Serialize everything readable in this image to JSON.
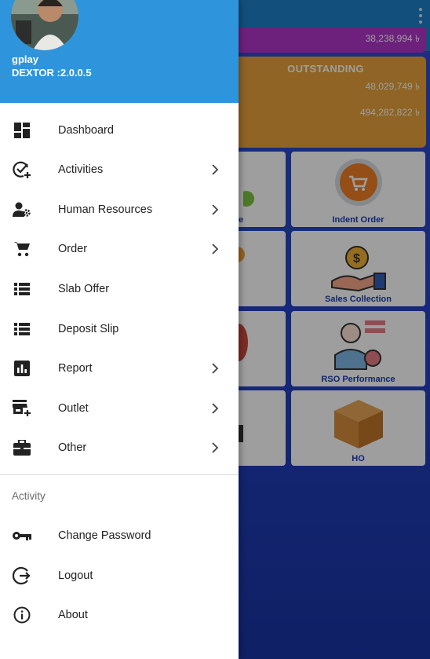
{
  "drawer": {
    "user_name": "gplay",
    "version": "DEXTOR :2.0.0.5",
    "items": [
      {
        "label": "Dashboard",
        "icon": "dashboard-icon",
        "has_submenu": false
      },
      {
        "label": "Activities",
        "icon": "activities-check-icon",
        "has_submenu": true
      },
      {
        "label": "Human Resources",
        "icon": "human-resources-icon",
        "has_submenu": true
      },
      {
        "label": "Order",
        "icon": "cart-icon",
        "has_submenu": true
      },
      {
        "label": "Slab Offer",
        "icon": "list-icon",
        "has_submenu": false
      },
      {
        "label": "Deposit Slip",
        "icon": "list-icon",
        "has_submenu": false
      },
      {
        "label": "Report",
        "icon": "report-chart-icon",
        "has_submenu": true
      },
      {
        "label": "Outlet",
        "icon": "store-add-icon",
        "has_submenu": true
      },
      {
        "label": "Other",
        "icon": "briefcase-icon",
        "has_submenu": true
      }
    ],
    "section_title": "Activity",
    "activity_items": [
      {
        "label": "Change Password",
        "icon": "key-icon"
      },
      {
        "label": "Logout",
        "icon": "logout-icon"
      },
      {
        "label": "About",
        "icon": "info-icon"
      }
    ]
  },
  "background": {
    "top_card_value": "38,238,994 ৳",
    "outstanding_title": "OUTSTANDING",
    "outstanding_value_1": "48,029,749 ৳",
    "outstanding_value_2": "494,282,822 ৳",
    "tiles_right": [
      "Indent Order",
      "Sales Collection",
      "RSO Performance",
      "HO"
    ],
    "tile_left_partial": [
      "e",
      "",
      "",
      ""
    ]
  },
  "colors": {
    "header_blue": "#2e95dc",
    "app_background": "#2340c0",
    "outstanding_card": "#e7a23a",
    "top_card": "#b036c8",
    "tile_label": "#1b3eb0"
  }
}
